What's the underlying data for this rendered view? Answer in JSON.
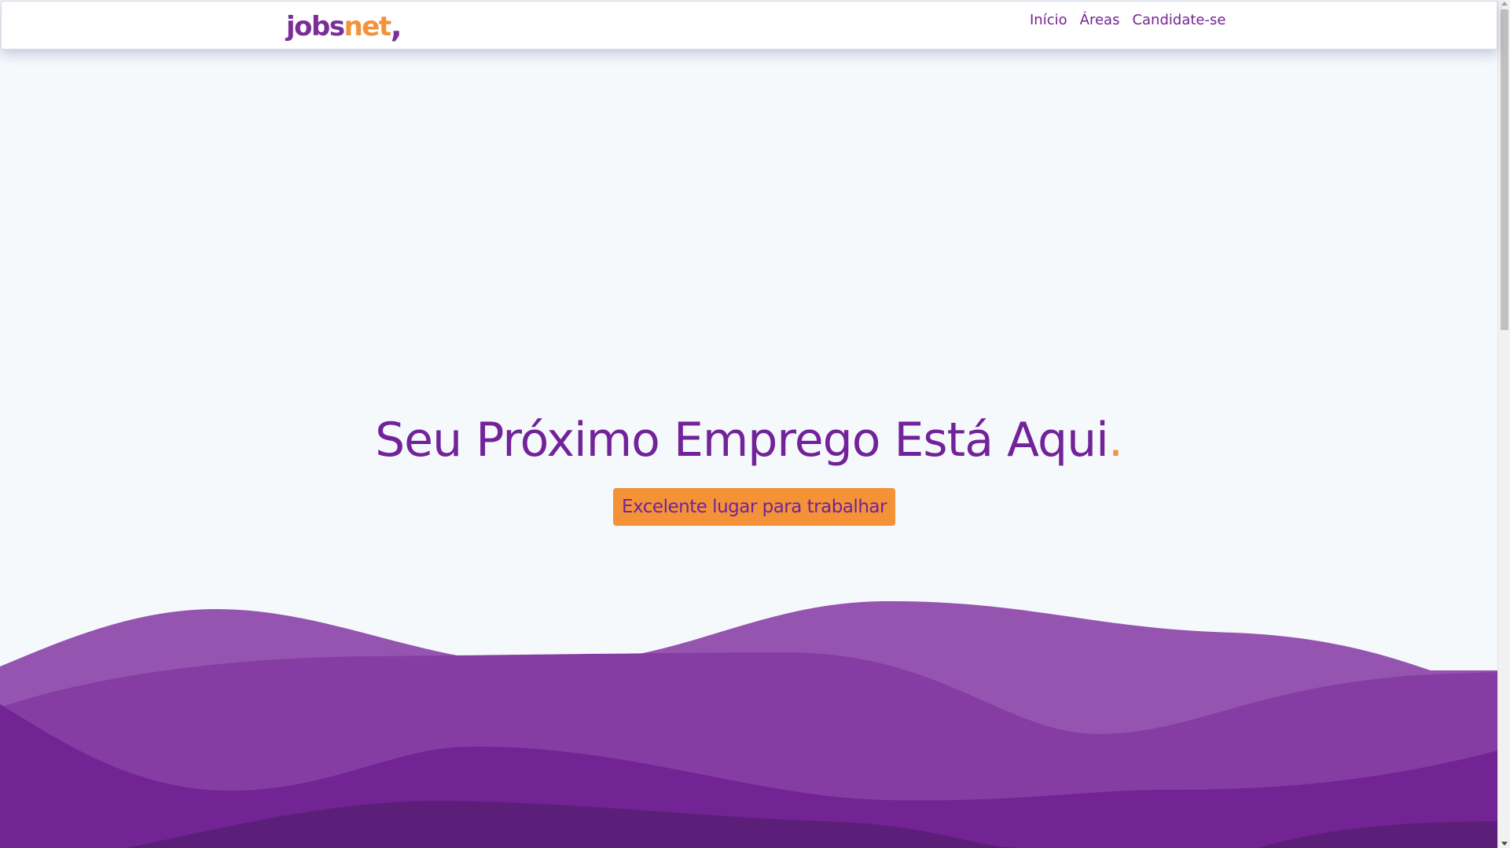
{
  "brand": {
    "logo_part1": "jobs",
    "logo_part2": "net",
    "logo_part3": ",",
    "primary_color": "#72239a",
    "accent_color": "#f39237"
  },
  "nav": {
    "items": [
      {
        "label": "Início"
      },
      {
        "label": "Áreas"
      },
      {
        "label": "Candidate-se"
      }
    ]
  },
  "hero": {
    "title": "Seu Próximo Emprego Está Aqui",
    "title_dot": ".",
    "button_label": "Excelente lugar para trabalhar"
  },
  "waves": {
    "colors": [
      "#9654b1",
      "#853da3",
      "#722494",
      "#5c1f79"
    ]
  }
}
